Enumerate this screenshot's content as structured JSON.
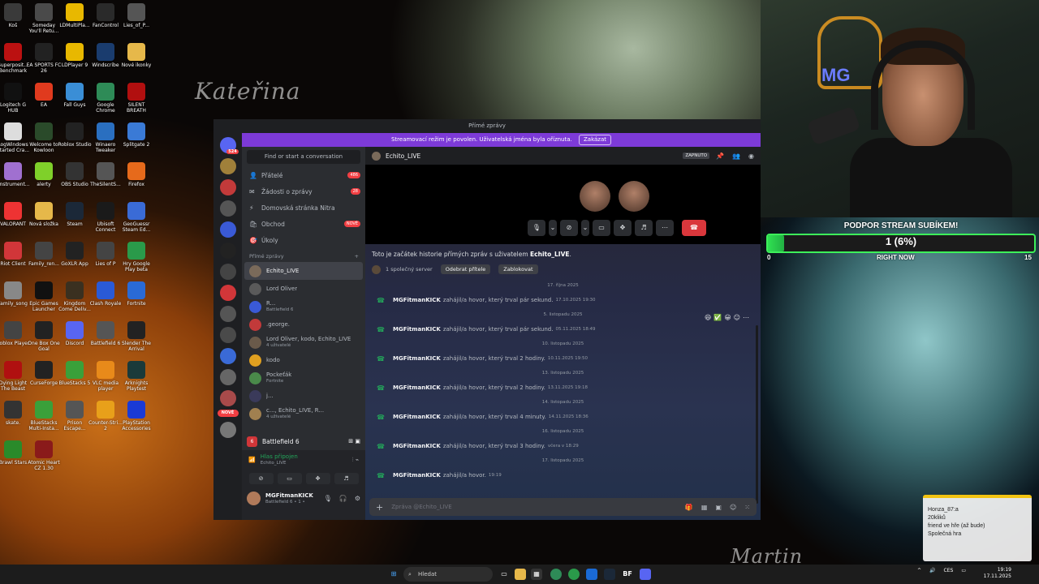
{
  "wallpaper": {
    "text_left": "Kateřina",
    "text_right": "Martin"
  },
  "desktop_icons": [
    {
      "label": "Koš",
      "icon": "recycle-bin-icon",
      "color": "#3a3a3a"
    },
    {
      "label": "Someday You'll Retu...",
      "icon": "game-icon",
      "color": "#4a4a4a"
    },
    {
      "label": "LDMultiPla...",
      "icon": "ldplayer-icon",
      "color": "#e8b800"
    },
    {
      "label": "FanControl",
      "icon": "fan-icon",
      "color": "#2a2a2a"
    },
    {
      "label": "Lies_of_P...",
      "icon": "game-icon",
      "color": "#555"
    },
    {
      "label": "Superposit... Benchmark",
      "icon": "benchmark-icon",
      "color": "#b11"
    },
    {
      "label": "EA SPORTS FC 26",
      "icon": "game-icon",
      "color": "#222"
    },
    {
      "label": "LDPlayer 9",
      "icon": "ldplayer-icon",
      "color": "#e8b800"
    },
    {
      "label": "Windscribe",
      "icon": "vpn-icon",
      "color": "#1a3c6e"
    },
    {
      "label": "Nové ikonky",
      "icon": "folder-icon",
      "color": "#e6b84a"
    },
    {
      "label": "Logitech G HUB",
      "icon": "logitech-icon",
      "color": "#111"
    },
    {
      "label": "EA",
      "icon": "ea-icon",
      "color": "#e03a1e"
    },
    {
      "label": "Fall Guys",
      "icon": "game-icon",
      "color": "#3a8ed6"
    },
    {
      "label": "Google Chrome",
      "icon": "chrome-icon",
      "color": "#2e8b57"
    },
    {
      "label": "SILENT BREATH",
      "icon": "game-icon",
      "color": "#b10f0f"
    },
    {
      "label": "LogWindows Started Cra...",
      "icon": "file-icon",
      "color": "#ddd"
    },
    {
      "label": "Welcome to Kowloon",
      "icon": "game-icon",
      "color": "#2a4a2a"
    },
    {
      "label": "Roblox Studio",
      "icon": "roblox-icon",
      "color": "#222"
    },
    {
      "label": "Winaero Tweaker",
      "icon": "tool-icon",
      "color": "#2a6fc0"
    },
    {
      "label": "Splitgate 2",
      "icon": "game-icon",
      "color": "#3a7ad6"
    },
    {
      "label": "(Instrument...",
      "icon": "image-icon",
      "color": "#a070d0"
    },
    {
      "label": "alerty",
      "icon": "folder-icon",
      "color": "#7fd02a"
    },
    {
      "label": "OBS Studio",
      "icon": "obs-icon",
      "color": "#333"
    },
    {
      "label": "TheSilentS...",
      "icon": "game-icon",
      "color": "#555"
    },
    {
      "label": "Firefox",
      "icon": "firefox-icon",
      "color": "#e66a1b"
    },
    {
      "label": "VALORANT",
      "icon": "valorant-icon",
      "color": "#e33"
    },
    {
      "label": "Nová složka",
      "icon": "folder-icon",
      "color": "#e6b84a"
    },
    {
      "label": "Steam",
      "icon": "steam-icon",
      "color": "#1b2838"
    },
    {
      "label": "Ubisoft Connect",
      "icon": "ubisoft-icon",
      "color": "#1a1a1a"
    },
    {
      "label": "GeoGuessr Steam Ed...",
      "icon": "map-icon",
      "color": "#3a6bd6"
    },
    {
      "label": "Riot Client",
      "icon": "riot-icon",
      "color": "#d13639"
    },
    {
      "label": "Family_ren...",
      "icon": "file-icon",
      "color": "#444"
    },
    {
      "label": "GoXLR App",
      "icon": "audio-icon",
      "color": "#222"
    },
    {
      "label": "Lies of P",
      "icon": "game-icon",
      "color": "#444"
    },
    {
      "label": "Hry Google Play beta",
      "icon": "play-icon",
      "color": "#2a9a4a"
    },
    {
      "label": "family_song",
      "icon": "audio-file-icon",
      "color": "#888"
    },
    {
      "label": "Epic Games Launcher",
      "icon": "epic-icon",
      "color": "#111"
    },
    {
      "label": "Kingdom Come Deliv...",
      "icon": "game-icon",
      "color": "#3a3020"
    },
    {
      "label": "Clash Royale",
      "icon": "game-icon",
      "color": "#2a5ad6"
    },
    {
      "label": "Fortnite",
      "icon": "fortnite-icon",
      "color": "#2a6ad6"
    },
    {
      "label": "Roblox Player",
      "icon": "roblox-icon",
      "color": "#444"
    },
    {
      "label": "One Box One Goal",
      "icon": "game-icon",
      "color": "#222"
    },
    {
      "label": "Discord",
      "icon": "discord-icon",
      "color": "#5865f2"
    },
    {
      "label": "Battlefield 6",
      "icon": "game-icon",
      "color": "#555"
    },
    {
      "label": "Slender The Arrival",
      "icon": "game-icon",
      "color": "#222"
    },
    {
      "label": "Dying Light The Beast",
      "icon": "game-icon",
      "color": "#b01010"
    },
    {
      "label": "CurseForge",
      "icon": "curseforge-icon",
      "color": "#222"
    },
    {
      "label": "BlueStacks 5",
      "icon": "bluestacks-icon",
      "color": "#3aa03a"
    },
    {
      "label": "VLC media player",
      "icon": "vlc-icon",
      "color": "#e88a1a"
    },
    {
      "label": "Arknights Playtest",
      "icon": "game-icon",
      "color": "#1a3a3a"
    },
    {
      "label": "skate.",
      "icon": "game-icon",
      "color": "#333"
    },
    {
      "label": "BlueStacks Multi-Insta...",
      "icon": "bluestacks-icon",
      "color": "#3aa03a"
    },
    {
      "label": "Prison Escape...",
      "icon": "game-icon",
      "color": "#555"
    },
    {
      "label": "Counter-Stri... 2",
      "icon": "game-icon",
      "color": "#e8a01a"
    },
    {
      "label": "PlayStation Accessories",
      "icon": "playstation-icon",
      "color": "#1a3ad6"
    },
    {
      "label": "Brawl Stars",
      "icon": "game-icon",
      "color": "#2a8a2a"
    },
    {
      "label": "Atomic Heart CZ 1.30",
      "icon": "game-icon",
      "color": "#8a1a1a"
    }
  ],
  "discord": {
    "window_title": "Přímé zprávy",
    "banner": {
      "text": "Streamovací režim je povolen. Uživatelská jména byla oříznuta.",
      "button": "Zakázat"
    },
    "servers": [
      {
        "label": "524",
        "color": "#5865f2"
      },
      {
        "label": "",
        "color": "#a0803a"
      },
      {
        "label": "",
        "color": "#c23a3a"
      },
      {
        "label": "",
        "color": "#555"
      },
      {
        "label": "",
        "color": "#3a5ad6"
      },
      {
        "label": "",
        "color": "#222"
      },
      {
        "label": "",
        "color": "#444"
      },
      {
        "label": "",
        "color": "#d13639"
      },
      {
        "label": "",
        "color": "#555"
      },
      {
        "label": "",
        "color": "#4a4a4a"
      },
      {
        "label": "",
        "color": "#3a6ad6"
      },
      {
        "label": "",
        "color": "#666"
      },
      {
        "label": "",
        "color": "#a84a4a"
      },
      {
        "label": "",
        "color": "#777"
      }
    ],
    "servers_new_badge": "NOVÉ",
    "search_placeholder": "Find or start a conversation",
    "nav": [
      {
        "label": "Přátelé",
        "icon": "friends-icon",
        "badge": "486"
      },
      {
        "label": "Žádosti o zprávy",
        "icon": "mail-icon",
        "badge": "28"
      },
      {
        "label": "Domovská stránka Nitra",
        "icon": "nitro-icon",
        "badge": ""
      },
      {
        "label": "Obchod",
        "icon": "shop-icon",
        "badge": "NOVÉ"
      },
      {
        "label": "Úkoly",
        "icon": "quest-icon",
        "badge": ""
      }
    ],
    "dm_header": "Přímé zprávy",
    "dms": [
      {
        "name": "Echito_LIVE",
        "sub": "",
        "color": "#7a6a5a",
        "active": true
      },
      {
        "name": "Lord Oliver",
        "sub": "",
        "color": "#5a5a5a",
        "active": false
      },
      {
        "name": "R...",
        "sub": "Battlefield 6",
        "color": "#3a5ad6",
        "active": false
      },
      {
        "name": ".george.",
        "sub": "",
        "color": "#c23a3a",
        "active": false
      },
      {
        "name": "Lord Oliver, kodo, Echito_LIVE",
        "sub": "4 uživatelé",
        "color": "#6a5a4a",
        "active": false
      },
      {
        "name": "kodo",
        "sub": "",
        "color": "#e0a020",
        "active": false
      },
      {
        "name": "Pockeťák",
        "sub": "Fortnite",
        "color": "#4a8a4a",
        "active": false
      },
      {
        "name": "j...",
        "sub": "",
        "color": "#3a3a5a",
        "active": false
      },
      {
        "name": "c..., Echito_LIVE, R...",
        "sub": "4 uživatelé",
        "color": "#a08050",
        "active": false
      }
    ],
    "voice": {
      "game": "Battlefield 6",
      "status": "Hlas připojen",
      "channel": "Echito_LIVE"
    },
    "user": {
      "name": "MGFitmanKICK",
      "status": "Battlefield 6 • 1 •"
    },
    "chat": {
      "title": "Echito_LIVE",
      "streamer_tag": "ZAPNUTO",
      "intro_prefix": "Toto je začátek historie přímých zpráv s uživatelem ",
      "intro_user": "Echito_LIVE",
      "mutual": "1 společný server",
      "remove_friend": "Odebrat přítele",
      "block": "Zablokovat",
      "messages": [
        {
          "date": "17. října 2025",
          "author": "MGFitmanKICK",
          "text": "zahájil/a hovor, který trval pár sekund.",
          "time": "17.10.2025 19:30"
        },
        {
          "date": "5. listopadu 2025",
          "author": "MGFitmanKICK",
          "text": "zahájil/a hovor, který trval pár sekund.",
          "time": "05.11.2025 18:49"
        },
        {
          "date": "10. listopadu 2025",
          "author": "MGFitmanKICK",
          "text": "zahájil/a hovor, který trval 2 hodiny.",
          "time": "10.11.2025 19:50"
        },
        {
          "date": "13. listopadu 2025",
          "author": "MGFitmanKICK",
          "text": "zahájil/a hovor, který trval 2 hodiny.",
          "time": "13.11.2025 19:18"
        },
        {
          "date": "14. listopadu 2025",
          "author": "MGFitmanKICK",
          "text": "zahájil/a hovor, který trval 4 minuty.",
          "time": "14.11.2025 18:36"
        },
        {
          "date": "16. listopadu 2025",
          "author": "MGFitmanKICK",
          "text": "zahájil/a hovor, který trval 3 hodiny.",
          "time": "včera v 18:29"
        },
        {
          "date": "17. listopadu 2025",
          "author": "MGFitmanKICK",
          "text": "zahájil/a hovor.",
          "time": "19:19"
        }
      ],
      "composer_placeholder": "Zpráva @Echito_LIVE"
    }
  },
  "stream": {
    "sub_title": "PODPOR STREAM SUBÍKEM!",
    "sub_value": "1 (6%)",
    "sub_progress": 0.06,
    "sub_min": "0",
    "sub_mid": "RIGHT NOW",
    "sub_max": "15",
    "overlay_lines": [
      "Honza_87:a",
      "20kliků",
      "friend ve hře (až bude)",
      "Společná hra"
    ]
  },
  "taskbar": {
    "search": "Hledat",
    "lang": "CES",
    "time": "19:19",
    "date": "17.11.2025"
  },
  "colors": {
    "accent": "#7d3ad8",
    "online": "#23a55a",
    "danger": "#da373c",
    "sub_green": "#2fe051"
  }
}
